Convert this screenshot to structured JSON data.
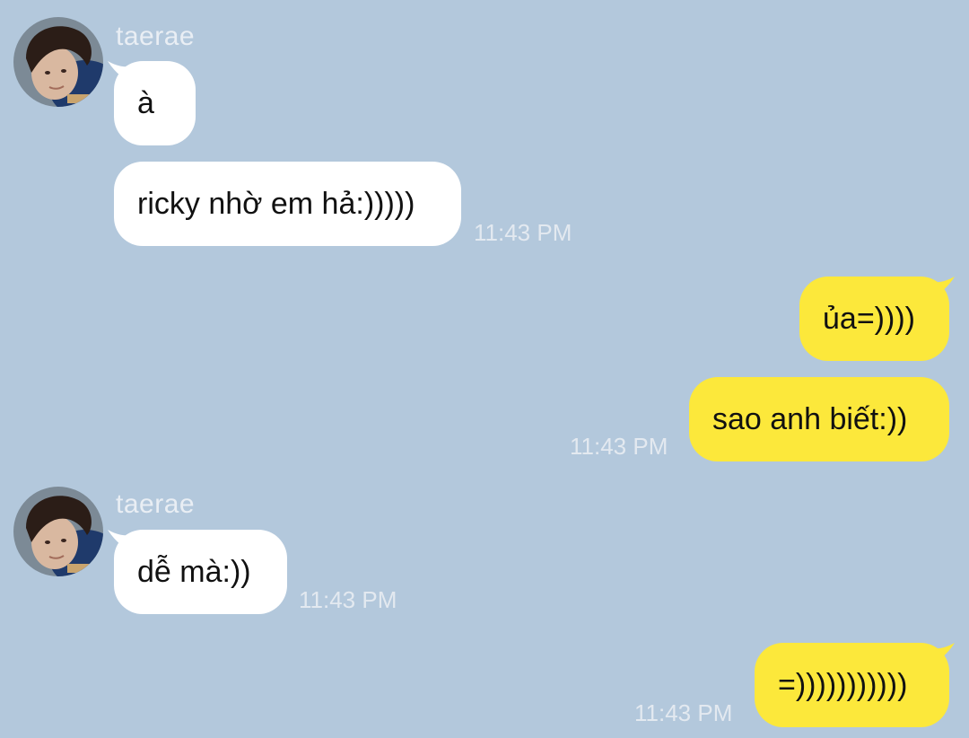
{
  "theme": {
    "background": "#b3c8dc",
    "incoming_bubble": "#ffffff",
    "outgoing_bubble": "#fce83b",
    "muted_text": "#e3e9f0"
  },
  "messages": [
    {
      "group": 1,
      "direction": "incoming",
      "sender": "taerae",
      "text": "à"
    },
    {
      "group": 1,
      "direction": "incoming",
      "text": "ricky nhờ em hả:)))))",
      "time": "11:43 PM"
    },
    {
      "group": 2,
      "direction": "outgoing",
      "text": "ủa=))))"
    },
    {
      "group": 2,
      "direction": "outgoing",
      "text": "sao anh biết:))",
      "time": "11:43 PM"
    },
    {
      "group": 3,
      "direction": "incoming",
      "sender": "taerae",
      "text": "dễ mà:))",
      "time": "11:43 PM"
    },
    {
      "group": 4,
      "direction": "outgoing",
      "text": "=)))))))))))",
      "time": "11:43 PM"
    }
  ]
}
